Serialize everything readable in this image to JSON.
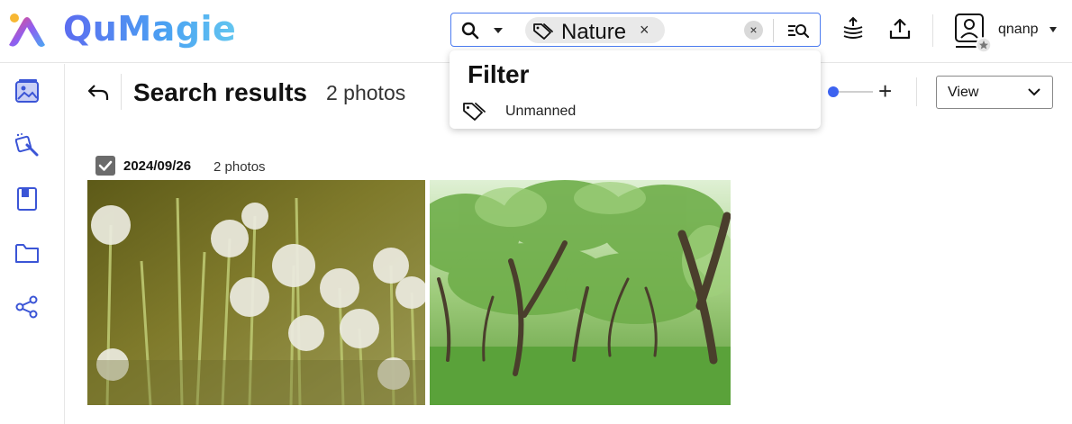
{
  "header": {
    "brand": "QuMagie",
    "search": {
      "chip_label": "Nature",
      "chip_remove": "×",
      "clear": "×"
    },
    "user": {
      "name": "qnanp"
    }
  },
  "sidebar": {
    "items": [
      {
        "icon": "photos-icon"
      },
      {
        "icon": "smart-album-icon"
      },
      {
        "icon": "album-icon"
      },
      {
        "icon": "folder-icon"
      },
      {
        "icon": "share-icon"
      }
    ]
  },
  "main": {
    "title": "Search results",
    "count": "2 photos",
    "zoom_plus": "+",
    "view_label": "View",
    "group": {
      "date": "2024/09/26",
      "count": "2 photos",
      "checked": true
    },
    "photos": [
      {
        "subject": "dandelions"
      },
      {
        "subject": "trees"
      }
    ]
  },
  "filter_dropdown": {
    "title": "Filter",
    "items": [
      {
        "label": "Unmanned",
        "icon": "tags-icon"
      }
    ]
  },
  "colors": {
    "accent": "#3d63f0",
    "search_border": "#4d7cf0",
    "sidebar_icon": "#3b55d6"
  }
}
